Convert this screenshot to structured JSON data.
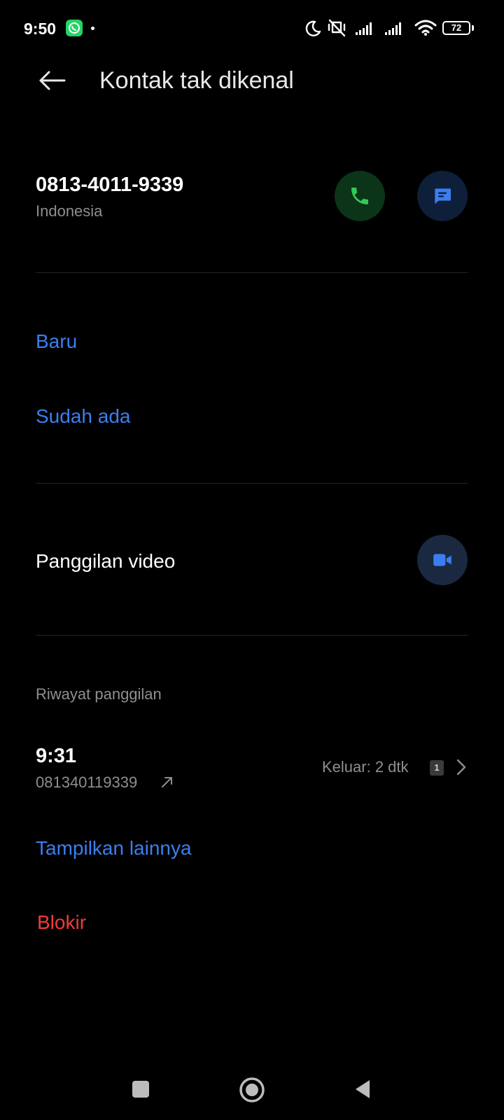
{
  "status_bar": {
    "time": "9:50",
    "battery": "72",
    "icons": [
      "whatsapp-icon",
      "moon-icon",
      "vibrate-off-icon",
      "signal-icon",
      "signal-icon",
      "wifi-icon",
      "battery-icon"
    ]
  },
  "app_bar": {
    "title": "Kontak tak dikenal",
    "back_icon": "arrow-left-icon"
  },
  "contact": {
    "number": "0813-4011-9339",
    "country": "Indonesia",
    "call_icon": "phone-icon",
    "message_icon": "message-icon"
  },
  "add_contact": {
    "new_label": "Baru",
    "existing_label": "Sudah ada"
  },
  "video": {
    "label": "Panggilan video",
    "icon": "video-camera-icon"
  },
  "history": {
    "section_label": "Riwayat panggilan",
    "entries": [
      {
        "time": "9:31",
        "number": "081340119339",
        "detail": "Keluar: 2 dtk",
        "sim": "1"
      }
    ],
    "show_more_label": "Tampilkan lainnya"
  },
  "actions": {
    "block_label": "Blokir"
  },
  "colors": {
    "accent": "#3b7ef0",
    "danger": "#ef3b3b",
    "call_green": "#2ecc55",
    "background": "#000000"
  }
}
